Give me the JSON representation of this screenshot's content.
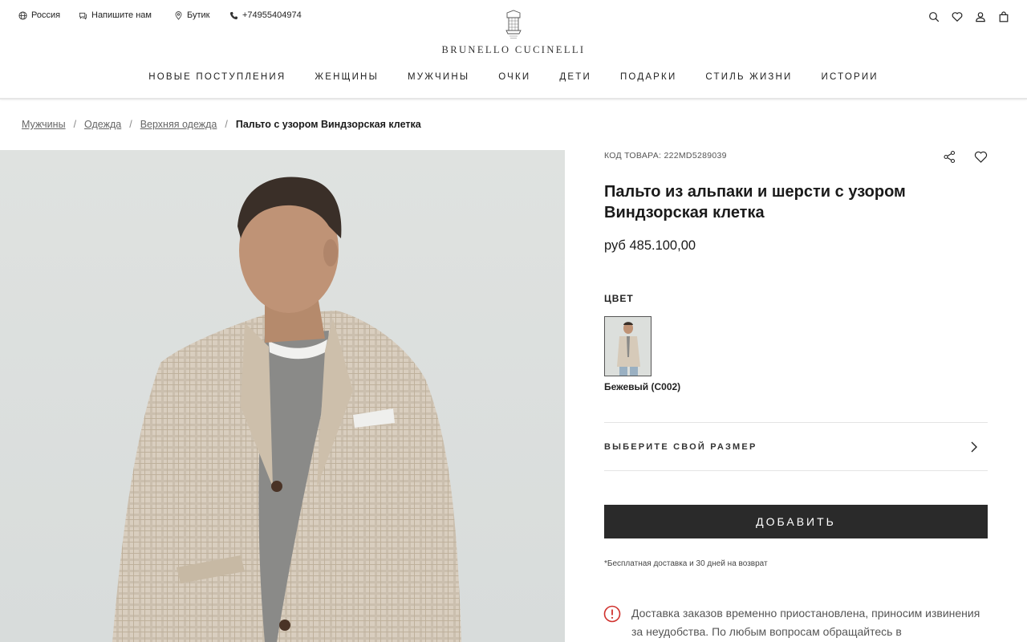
{
  "topbar": {
    "region": "Россия",
    "contact": "Напишите нам",
    "boutique": "Бутик",
    "phone": "+74955404974"
  },
  "brand": {
    "name": "BRUNELLO CUCINELLI"
  },
  "nav": [
    "НОВЫЕ ПОСТУПЛЕНИЯ",
    "ЖЕНЩИНЫ",
    "МУЖЧИНЫ",
    "ОЧКИ",
    "ДЕТИ",
    "ПОДАРКИ",
    "СТИЛЬ ЖИЗНИ",
    "ИСТОРИИ"
  ],
  "breadcrumb": {
    "items": [
      "Мужчины",
      "Одежда",
      "Верхняя одежда"
    ],
    "current": "Пальто с узором Виндзорская клетка"
  },
  "product": {
    "sku_label": "КОД ТОВАРА: 222MD5289039",
    "title": "Пальто из альпаки и шерсти с узором Виндзорская клетка",
    "price": "руб 485.100,00",
    "color_label": "ЦВЕТ",
    "color_name": "Бежевый (C002)",
    "size_label": "ВЫБЕРИТЕ СВОЙ РАЗМЕР",
    "add_label": "ДОБАВИТЬ",
    "shipping_note": "*Бесплатная доставка и 30 дней на возврат",
    "alert_text": "Доставка заказов временно приостановлена, приносим извинения за неудобства. По любым вопросам обращайтесь в"
  },
  "icons": {
    "globe": "globe-icon",
    "chat": "chat-icon",
    "pin": "location-pin-icon",
    "phone": "phone-icon",
    "search": "search-icon",
    "heart": "heart-icon",
    "user": "user-icon",
    "bag": "shopping-bag-icon",
    "share": "share-icon",
    "chevron": "chevron-right-icon",
    "alert": "alert-circle-icon"
  },
  "colors": {
    "button_bg": "#2a2a2a",
    "alert_red": "#d0312d",
    "image_bg": "#dcdfdd",
    "coat": "#d8cdbd"
  }
}
